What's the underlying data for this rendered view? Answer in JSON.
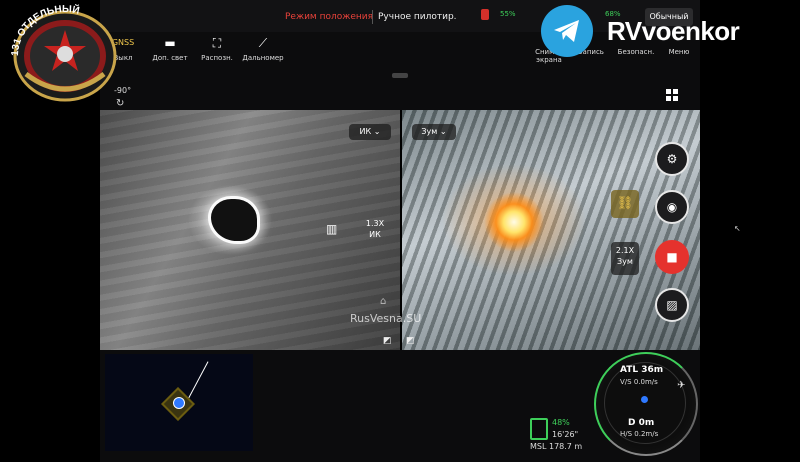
{
  "status_bar": {
    "mode_label": "Режим положения",
    "pilot_mode": "Ручное пилотир.",
    "signal_left": "55%",
    "signal_right": "68%",
    "profile": "Обычный"
  },
  "toolbar": {
    "gnss": "GNSS",
    "gnss_sub": "Выкл",
    "extra_light": "Доп. свет",
    "recognize": "Распозн.",
    "rangefinder": "Дальномер",
    "snap_screen_top": "Снимок",
    "snap_screen_bottom": "экрана",
    "write": "Запись",
    "safety": "Безопасн.",
    "menu": "Меню"
  },
  "gimbal": {
    "angle": "-90°"
  },
  "left_feed": {
    "lens_select": "ИК ⌄",
    "zoom_value": "1.3X",
    "zoom_mode": "ИК"
  },
  "right_feed": {
    "lens_select": "Зум ⌄",
    "zoom_value": "2.1X",
    "zoom_mode": "Зум"
  },
  "watermark": "RusVesna.SU",
  "telemetry": {
    "battery_pct": "48%",
    "flight_time": "16'26\"",
    "msl": "MSL 178.7 m",
    "atl": "ATL 36m",
    "vs": "V/S 0.0m/s",
    "d": "D  0m",
    "hs": "H/S 0.2m/s"
  },
  "overlay": {
    "brand": "RVvoenkor",
    "emblem_text": "131 ОТДЕЛЬНЫЙ"
  },
  "colors": {
    "accent_red": "#e5322d",
    "accent_green": "#3ecf5a",
    "telegram_blue": "#2aa3df"
  }
}
